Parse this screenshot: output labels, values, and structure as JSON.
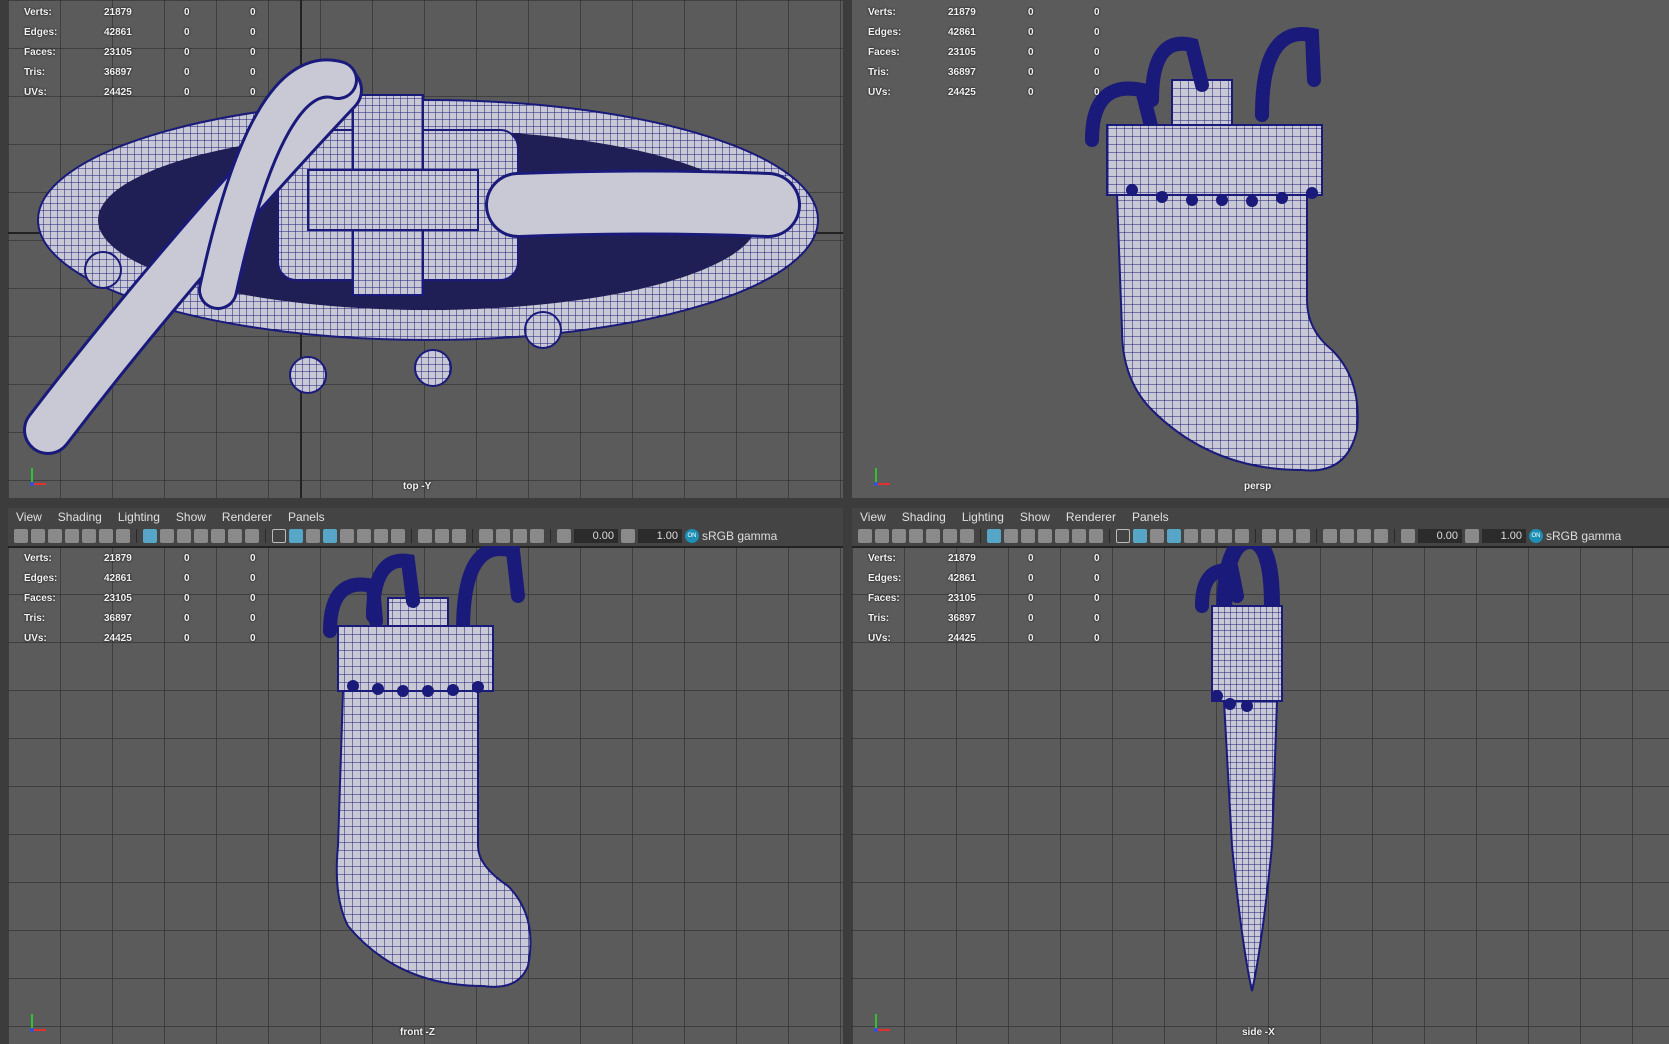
{
  "stats": {
    "rows": [
      {
        "label": "Verts:",
        "v1": "21879",
        "v2": "0",
        "v3": "0"
      },
      {
        "label": "Edges:",
        "v1": "42861",
        "v2": "0",
        "v3": "0"
      },
      {
        "label": "Faces:",
        "v1": "23105",
        "v2": "0",
        "v3": "0"
      },
      {
        "label": "Tris:",
        "v1": "36897",
        "v2": "0",
        "v3": "0"
      },
      {
        "label": "UVs:",
        "v1": "24425",
        "v2": "0",
        "v3": "0"
      }
    ]
  },
  "viewports": {
    "top": {
      "camera": "top -Y"
    },
    "persp": {
      "camera": "persp"
    },
    "front": {
      "camera": "front -Z"
    },
    "side": {
      "camera": "side -X"
    }
  },
  "menu": [
    "View",
    "Shading",
    "Lighting",
    "Show",
    "Renderer",
    "Panels"
  ],
  "toolbar": {
    "exposure": "0.00",
    "gamma": "1.00",
    "color_space": "sRGB gamma",
    "cm_badge": "ON"
  },
  "colors": {
    "wire": "#1a1a7a",
    "surface": "#c9c9d6",
    "viewport_bg": "#5b5b5b",
    "accent": "#56a6c8"
  }
}
